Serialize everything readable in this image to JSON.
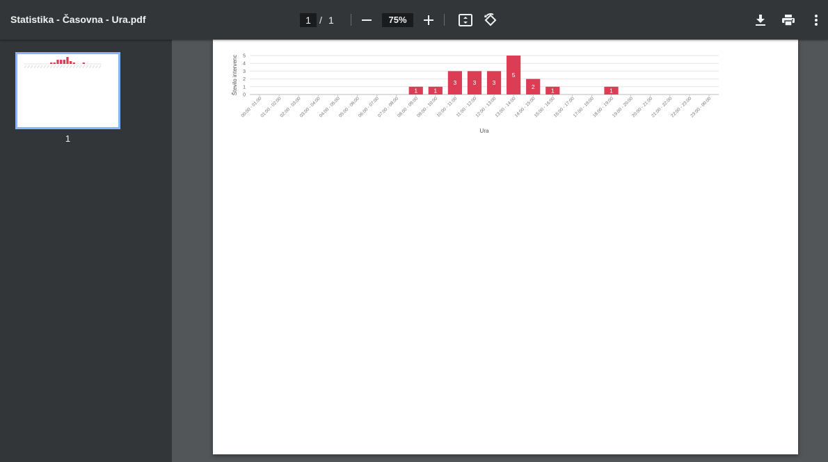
{
  "toolbar": {
    "title": "Statistika - Časovna - Ura.pdf",
    "page_current": "1",
    "page_separator": "/",
    "page_total": "1",
    "zoom": "75%"
  },
  "sidebar": {
    "thumbnail_label": "1"
  },
  "colors": {
    "toolbar": "#323639",
    "viewer_bg": "#525659",
    "bar": "#dc3d55",
    "thumb_border": "#8ab4f8"
  },
  "chart_data": {
    "type": "bar",
    "title": "",
    "xlabel": "Ura",
    "ylabel": "Število intervenc",
    "ylim": [
      0,
      5
    ],
    "yticks": [
      "0",
      "1",
      "2",
      "3",
      "4",
      "5"
    ],
    "categories": [
      "00:00 - 01:00",
      "01:00 - 02:00",
      "02:00 - 03:00",
      "03:00 - 04:00",
      "04:00 - 05:00",
      "05:00 - 06:00",
      "06:00 - 07:00",
      "07:00 - 08:00",
      "08:00 - 09:00",
      "09:00 - 10:00",
      "10:00 - 11:00",
      "11:00 - 12:00",
      "12:00 - 13:00",
      "13:00 - 14:00",
      "14:00 - 15:00",
      "15:00 - 16:00",
      "16:00 - 17:00",
      "17:00 - 18:00",
      "18:00 - 19:00",
      "19:00 - 20:00",
      "20:00 - 21:00",
      "21:00 - 22:00",
      "22:00 - 23:00",
      "23:00 - 00:00"
    ],
    "values": [
      0,
      0,
      0,
      0,
      0,
      0,
      0,
      0,
      1,
      1,
      3,
      3,
      3,
      5,
      2,
      1,
      0,
      0,
      1,
      0,
      0,
      0,
      0,
      0
    ],
    "grid": true,
    "legend": "none"
  }
}
